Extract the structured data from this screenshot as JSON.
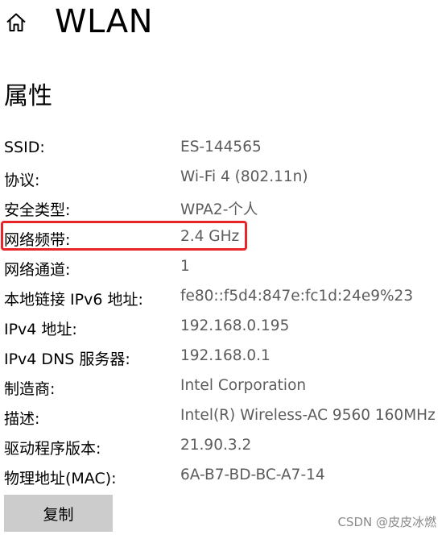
{
  "header": {
    "home_icon": "home-icon",
    "title": "WLAN"
  },
  "section": {
    "title": "属性"
  },
  "properties": [
    {
      "label": "SSID:",
      "value": "ES-144565"
    },
    {
      "label": "协议:",
      "value": "Wi-Fi 4 (802.11n)"
    },
    {
      "label": "安全类型:",
      "value": "WPA2-个人"
    },
    {
      "label": "网络频带:",
      "value": "2.4 GHz"
    },
    {
      "label": "网络通道:",
      "value": "1"
    },
    {
      "label": "本地链接 IPv6 地址:",
      "value": "fe80::f5d4:847e:fc1d:24e9%23"
    },
    {
      "label": "IPv4 地址:",
      "value": "192.168.0.195"
    },
    {
      "label": "IPv4 DNS 服务器:",
      "value": "192.168.0.1"
    },
    {
      "label": "制造商:",
      "value": "Intel Corporation"
    },
    {
      "label": "描述:",
      "value": "Intel(R) Wireless-AC 9560 160MHz"
    },
    {
      "label": "驱动程序版本:",
      "value": "21.90.3.2"
    },
    {
      "label": "物理地址(MAC):",
      "value": "6A-B7-BD-BC-A7-14"
    }
  ],
  "copy_button": {
    "label": "复制"
  },
  "watermark": "CSDN @皮皮冰燃",
  "colors": {
    "highlight": "#e8262a",
    "value_text": "#5c5c5c",
    "button_bg": "#cccccc"
  }
}
